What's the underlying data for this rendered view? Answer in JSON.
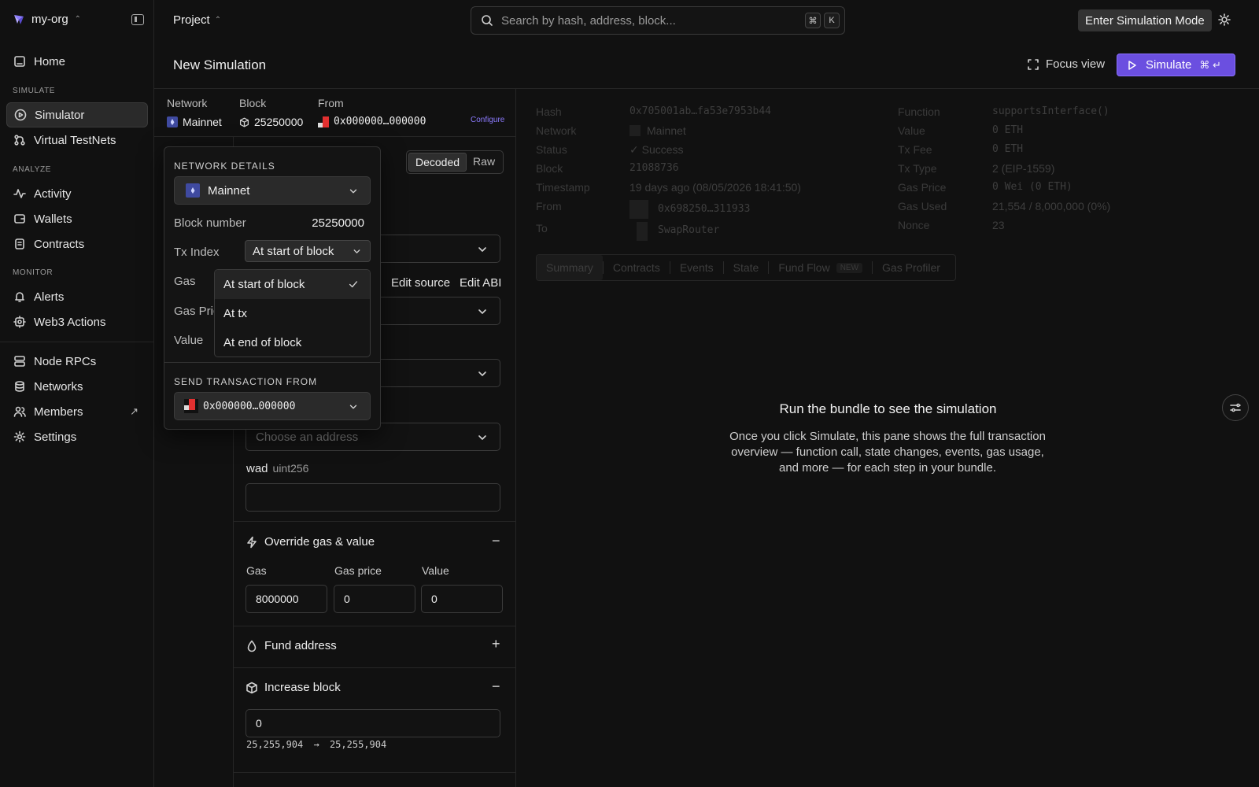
{
  "sidebar": {
    "org_name": "my-org",
    "items": {
      "home": "Home",
      "simulator": "Simulator",
      "virtual_testnets": "Virtual TestNets",
      "activity": "Activity",
      "wallets": "Wallets",
      "contracts": "Contracts",
      "alerts": "Alerts",
      "web3_actions": "Web3 Actions",
      "node_rpcs": "Node RPCs",
      "networks": "Networks",
      "members": "Members",
      "settings": "Settings"
    },
    "sections": {
      "simulate": "SIMULATE",
      "analyze": "ANALYZE",
      "monitor": "MONITOR"
    }
  },
  "topbar": {
    "project": "Project",
    "search_placeholder": "Search by hash, address, block...",
    "kbd_cmd": "⌘",
    "kbd_k": "K",
    "enter_simulation_mode": "Enter Simulation Mode"
  },
  "header": {
    "title": "New Simulation",
    "focus_view": "Focus view",
    "simulate": "Simulate",
    "simulate_kbd": "⌘ ↵"
  },
  "summary": {
    "network_label": "Network",
    "network_value": "Mainnet",
    "block_label": "Block",
    "block_value": "25250000",
    "from_label": "From",
    "from_value": "0x000000…000000",
    "configure": "Configure"
  },
  "form": {
    "view_toggle": {
      "decoded": "Decoded",
      "raw": "Raw"
    },
    "edit_source": "Edit source",
    "edit_abi": "Edit ABI",
    "address_placeholder": "Choose an address",
    "wad_label": "wad",
    "wad_type": "uint256",
    "override_title": "Override gas & value",
    "gas_label": "Gas",
    "gas_price_label": "Gas price",
    "value_label": "Value",
    "gas_value": "8000000",
    "gas_price_value": "0",
    "value_value": "0",
    "fund_address": "Fund address",
    "increase_block": "Increase block",
    "increase_block_value": "0",
    "block_from": "25,255,904",
    "block_arrow": "→",
    "block_to": "25,255,904"
  },
  "popover": {
    "network_details": "NETWORK DETAILS",
    "network": "Mainnet",
    "block_number_label": "Block number",
    "block_number": "25250000",
    "tx_index_label": "Tx Index",
    "tx_index_value": "At start of block",
    "gas_label": "Gas",
    "gas_price_label": "Gas Pric",
    "value_label": "Value",
    "send_from": "SEND TRANSACTION FROM",
    "send_from_value": "0x000000…000000",
    "options": [
      "At start of block",
      "At tx",
      "At end of block"
    ]
  },
  "details": {
    "hash_label": "Hash",
    "hash": "0x705001ab…fa53e7953b44",
    "network_label": "Network",
    "network": "Mainnet",
    "status_label": "Status",
    "status": "✓ Success",
    "block_label": "Block",
    "block": "21088736",
    "timestamp_label": "Timestamp",
    "timestamp": "19 days ago (08/05/2026 18:41:50)",
    "from_label": "From",
    "from": "0x698250…311933",
    "to_label": "To",
    "to": "SwapRouter",
    "function_label": "Function",
    "function": "supportsInterface()",
    "value_label": "Value",
    "value": "0 ETH",
    "tx_fee_label": "Tx Fee",
    "tx_fee": "0 ETH",
    "tx_type_label": "Tx Type",
    "tx_type": "2 (EIP-1559)",
    "gas_price_label": "Gas Price",
    "gas_price": "0 Wei (0 ETH)",
    "gas_used_label": "Gas Used",
    "gas_used": "21,554 / 8,000,000 (0%)",
    "nonce_label": "Nonce",
    "nonce": "23",
    "tabs": {
      "summary": "Summary",
      "contracts": "Contracts",
      "events": "Events",
      "state": "State",
      "fund_flow": "Fund Flow",
      "new_badge": "NEW",
      "gas_profiler": "Gas Profiler"
    }
  },
  "empty_state": {
    "title": "Run the bundle to see the simulation",
    "text": "Once you click Simulate, this pane shows the full transaction overview — function call, state changes, events, gas usage, and more — for each step in your bundle."
  },
  "colors": {
    "accent": "#6b4fe0",
    "link": "#8c7bff",
    "background": "#111111"
  }
}
